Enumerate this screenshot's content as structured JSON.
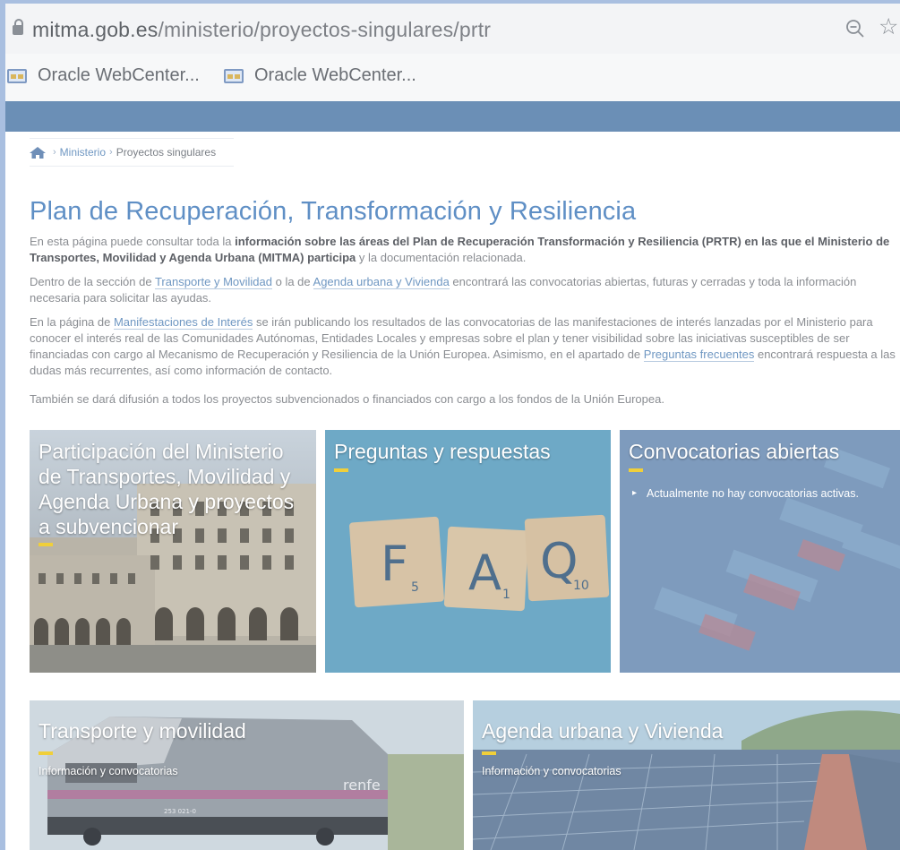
{
  "browser": {
    "url_host": "mitma.gob.es",
    "url_path": "/ministerio/proyectos-singulares/prtr",
    "bookmarks": [
      {
        "label": "Oracle WebCenter..."
      },
      {
        "label": "Oracle WebCenter..."
      }
    ]
  },
  "breadcrumb": {
    "items": [
      "Ministerio",
      "Proyectos singulares"
    ]
  },
  "page": {
    "title": "Plan de Recuperación, Transformación y Resiliencia",
    "p1_before": "En esta página puede consultar toda la ",
    "p1_bold": "información sobre las áreas del Plan de Recuperación Transformación y Resiliencia (PRTR) en las que el Ministerio de Transportes, Movilidad y Agenda Urbana (MITMA) participa",
    "p1_after": " y la documentación relacionada.",
    "p2_before": "Dentro de la sección de ",
    "p2_link1": "Transporte y Movilidad",
    "p2_mid": " o la de ",
    "p2_link2": "Agenda urbana y Vivienda",
    "p2_after": " encontrará las convocatorias abiertas, futuras y cerradas y toda la información necesaria para solicitar las ayudas.",
    "p3_before": "En la página de ",
    "p3_link1": "Manifestaciones de Interés",
    "p3_mid": " se irán publicando los resultados de las convocatorias de las manifestaciones de interés lanzadas por el Ministerio para conocer el interés real de las Comunidades Autónomas, Entidades Locales y empresas sobre el plan y tener visibilidad sobre las iniciativas susceptibles de ser financiadas con cargo al Mecanismo de Recuperación y Resiliencia de la Unión Europea. Asimismo, en el apartado de ",
    "p3_link2": "Preguntas frecuentes",
    "p3_after": " encontrará respuesta a las dudas más recurrentes, así como información de contacto.",
    "p4": "También se dará difusión a todos los proyectos subvencionados o financiados con cargo a los fondos de la Unión Europea."
  },
  "tiles": {
    "participacion": {
      "title": "Participación del Ministerio de Transportes, Movilidad y Agenda Urbana y proyectos a subvencionar"
    },
    "faq": {
      "title": "Preguntas y respuestas",
      "letters": [
        "F",
        "A",
        "Q"
      ],
      "subs": [
        "5",
        "1",
        "10"
      ]
    },
    "convocatorias": {
      "title": "Convocatorias abiertas",
      "bullet": "Actualmente no hay convocatorias activas."
    },
    "transporte": {
      "title": "Transporte y movilidad",
      "sub": "Información y convocatorias",
      "train_brand": "renfe",
      "train_number": "253 021-0"
    },
    "agenda": {
      "title": "Agenda urbana y Vivienda",
      "sub": "Información y convocatorias"
    }
  },
  "colors": {
    "accent": "#5f8fc5",
    "dash": "#f0cf3a",
    "banner": "#6b8fb6"
  }
}
